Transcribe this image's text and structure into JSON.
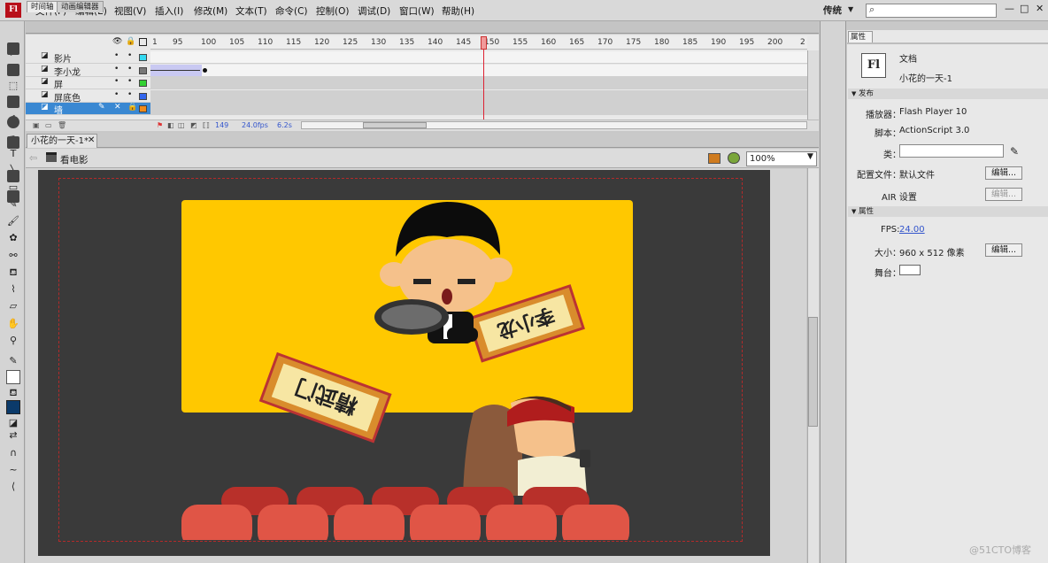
{
  "app": {
    "logo": "Fl",
    "workspace": "传统",
    "search_placeholder": ""
  },
  "menu": [
    "文件(F)",
    "编辑(E)",
    "视图(V)",
    "插入(I)",
    "修改(M)",
    "文本(T)",
    "命令(C)",
    "控制(O)",
    "调试(D)",
    "窗口(W)",
    "帮助(H)"
  ],
  "window_buttons": [
    "—",
    "□",
    "✕"
  ],
  "timeline": {
    "tabs": [
      "时间轴",
      "动画编辑器"
    ],
    "layers": [
      {
        "name": "影片",
        "color": "#33d9f0"
      },
      {
        "name": "李小龙",
        "color": "#777777"
      },
      {
        "name": "屏",
        "color": "#33d133"
      },
      {
        "name": "屏底色",
        "color": "#3366ee"
      },
      {
        "name": "墙",
        "color": "#f08a1a"
      }
    ],
    "ticks": [
      "95",
      "100",
      "105",
      "110",
      "115",
      "120",
      "125",
      "130",
      "135",
      "140",
      "145",
      "150",
      "155",
      "160",
      "165",
      "170",
      "175",
      "180",
      "185",
      "190",
      "195",
      "200",
      "2"
    ],
    "ruler_start": "1",
    "current_frame": "149",
    "fps": "24.0fps",
    "time": "6.2s"
  },
  "document": {
    "tab": "小花的一天-1*",
    "close": "✕",
    "scene": "看电影",
    "zoom": "100%"
  },
  "stage": {
    "stage_color": "#3a3a3a",
    "screen_color": "#ffc800",
    "sign_texts": [
      "李小龙",
      "精武门"
    ]
  },
  "properties": {
    "tab": "属性",
    "doc_type": "文档",
    "doc_name": "小花的一天-1",
    "publish_section": "发布",
    "player_label": "播放器：",
    "player_value": "Flash Player 10",
    "script_label": "脚本：",
    "script_value": "ActionScript 3.0",
    "class_label": "类：",
    "profile_label": "配置文件：",
    "profile_value": "默认文件",
    "edit_button": "编辑...",
    "air_label": "AIR 设置",
    "props_section": "属性",
    "fps_label": "FPS:",
    "fps_value": "24.00",
    "size_label": "大小：",
    "size_value": "960 x 512 像素",
    "stage_label": "舞台："
  },
  "watermark": "@51CTO博客"
}
